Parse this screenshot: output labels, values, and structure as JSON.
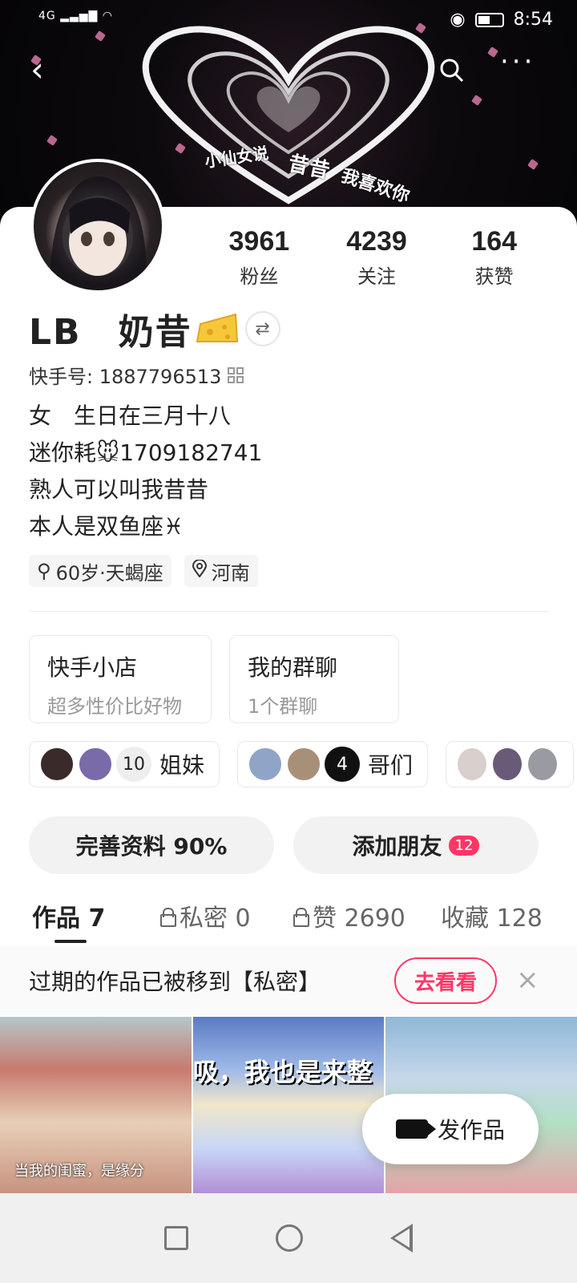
{
  "status_bar": {
    "network": "4G",
    "time": "8:54"
  },
  "banner": {
    "text_1": "小仙女说",
    "text_2": "昔昔",
    "text_3": "我喜欢你"
  },
  "profile": {
    "name": "LB　奶昔",
    "kuaishou_id_label": "快手号: 1887796513",
    "bio_lines": [
      "女　生日在三月十八",
      "迷你耗🐭1709182741",
      "熟人可以叫我昔昔",
      "本人是双鱼座♓"
    ],
    "tags": [
      {
        "label": "60岁·天蝎座",
        "icon": "gender-icon"
      },
      {
        "label": "河南",
        "icon": "location-icon"
      }
    ]
  },
  "stats": [
    {
      "value": "3961",
      "label": "粉丝"
    },
    {
      "value": "4239",
      "label": "关注"
    },
    {
      "value": "164",
      "label": "获赞"
    }
  ],
  "mini_cards": [
    {
      "title": "快手小店",
      "subtitle": "超多性价比好物"
    },
    {
      "title": "我的群聊",
      "subtitle": "1个群聊"
    }
  ],
  "groups": [
    {
      "count": "10",
      "label": "姐妹"
    },
    {
      "count": "4",
      "label": "哥们"
    }
  ],
  "actions": {
    "complete_profile": "完善资料 90%",
    "add_friend": "添加朋友",
    "add_friend_badge": "12"
  },
  "tabs": [
    {
      "label": "作品 7"
    },
    {
      "label": "私密 0"
    },
    {
      "label": "赞 2690"
    },
    {
      "label": "收藏 128"
    }
  ],
  "notice": {
    "text": "过期的作品已被移到【私密】",
    "button": "去看看",
    "close": "×"
  },
  "thumbs": {
    "caption_1": "当我的闺蜜，是缘分",
    "big_text_2": "吸，我也是来整"
  },
  "fab": {
    "label": "发作品"
  },
  "colors": {
    "accent": "#fe3666",
    "badge_bg": "#fe3666",
    "banner_sparkle": "#e67fb0"
  }
}
